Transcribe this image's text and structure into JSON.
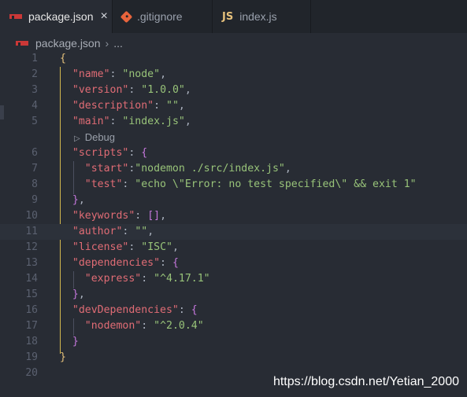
{
  "tabs": [
    {
      "label": "package.json",
      "icon": "npm-icon",
      "active": true,
      "close": "×"
    },
    {
      "label": ".gitignore",
      "icon": "git-icon",
      "active": false
    },
    {
      "label": "index.js",
      "icon": "js-icon",
      "icon_text": "JS",
      "active": false
    }
  ],
  "breadcrumb": {
    "file": "package.json",
    "separator": "›",
    "trail": "..."
  },
  "codelens": {
    "label": "Debug",
    "icon": "play-triangle-icon"
  },
  "watermark": "https://blog.csdn.net/Yetian_2000",
  "lines": [
    {
      "n": "1"
    },
    {
      "n": "2"
    },
    {
      "n": "3"
    },
    {
      "n": "4"
    },
    {
      "n": "5"
    },
    {
      "n": "6"
    },
    {
      "n": "7"
    },
    {
      "n": "8"
    },
    {
      "n": "9"
    },
    {
      "n": "10"
    },
    {
      "n": "11"
    },
    {
      "n": "12"
    },
    {
      "n": "13"
    },
    {
      "n": "14"
    },
    {
      "n": "15"
    },
    {
      "n": "16"
    },
    {
      "n": "17"
    },
    {
      "n": "18"
    },
    {
      "n": "19"
    },
    {
      "n": "20"
    }
  ],
  "code": {
    "l1": {
      "brace": "{"
    },
    "l2": {
      "key": "\"name\"",
      "colon": ": ",
      "val": "\"node\"",
      "tail": ","
    },
    "l3": {
      "key": "\"version\"",
      "colon": ": ",
      "val": "\"1.0.0\"",
      "tail": ","
    },
    "l4": {
      "key": "\"description\"",
      "colon": ": ",
      "val": "\"\"",
      "tail": ","
    },
    "l5": {
      "key": "\"main\"",
      "colon": ": ",
      "val": "\"index.js\"",
      "tail": ","
    },
    "l6": {
      "key": "\"scripts\"",
      "colon": ": ",
      "open": "{"
    },
    "l7": {
      "key": "\"start\"",
      "colon": ":",
      "val": "\"nodemon ./src/index.js\"",
      "tail": ","
    },
    "l8": {
      "key": "\"test\"",
      "colon": ": ",
      "val": "\"echo \\\"Error: no test specified\\\" && exit 1\""
    },
    "l9": {
      "close": "}",
      "tail": ","
    },
    "l10": {
      "key": "\"keywords\"",
      "colon": ": ",
      "arr": "[]",
      "tail": ","
    },
    "l11": {
      "key": "\"author\"",
      "colon": ": ",
      "val": "\"\"",
      "tail": ","
    },
    "l12": {
      "key": "\"license\"",
      "colon": ": ",
      "val": "\"ISC\"",
      "tail": ","
    },
    "l13": {
      "key": "\"dependencies\"",
      "colon": ": ",
      "open": "{"
    },
    "l14": {
      "key": "\"express\"",
      "colon": ": ",
      "val": "\"^4.17.1\""
    },
    "l15": {
      "close": "}",
      "tail": ","
    },
    "l16": {
      "key": "\"devDependencies\"",
      "colon": ": ",
      "open": "{"
    },
    "l17": {
      "key": "\"nodemon\"",
      "colon": ": ",
      "val": "\"^2.0.4\""
    },
    "l18": {
      "close": "}"
    },
    "l19": {
      "brace": "}"
    }
  },
  "colors": {
    "key": "#e06c75",
    "string": "#98c379",
    "bracket": "#c678dd",
    "root_brace": "#e5c07b",
    "background": "#282c34"
  }
}
